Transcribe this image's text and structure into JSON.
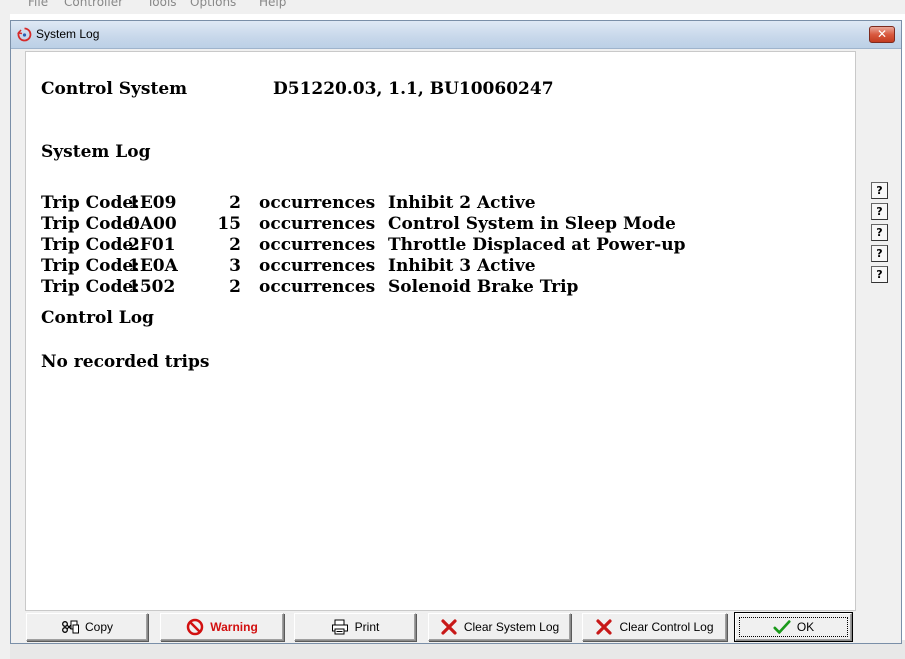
{
  "app_menu": [
    "File",
    "Controller",
    "Tools",
    "Options",
    "Help"
  ],
  "window": {
    "title": "System Log",
    "close_glyph": "✕"
  },
  "log": {
    "control_system_label": "Control System",
    "control_system_value": "D51220.03, 1.1, BU10060247",
    "system_log_heading": "System Log",
    "trip_label": "Trip Code:",
    "occurrences_label": "occurrences",
    "trips": [
      {
        "code": "1E09",
        "count": "2",
        "description": "Inhibit 2 Active"
      },
      {
        "code": "0A00",
        "count": "15",
        "description": "Control System in Sleep Mode"
      },
      {
        "code": "2F01",
        "count": "2",
        "description": "Throttle Displaced at Power-up"
      },
      {
        "code": "1E0A",
        "count": "3",
        "description": "Inhibit 3 Active"
      },
      {
        "code": "1502",
        "count": "2",
        "description": "Solenoid Brake Trip"
      }
    ],
    "control_log_heading": "Control Log",
    "control_log_status": "No recorded trips"
  },
  "help_buttons": [
    "?",
    "?",
    "?",
    "?",
    "?"
  ],
  "buttons": {
    "copy": "Copy",
    "warning": "Warning",
    "print": "Print",
    "clear_system_log": "Clear System Log",
    "clear_control_log": "Clear Control Log",
    "ok": "OK"
  },
  "colors": {
    "warning_text": "#d21010",
    "clear_x": "#c81818",
    "ok_check": "#1a9a1a"
  }
}
